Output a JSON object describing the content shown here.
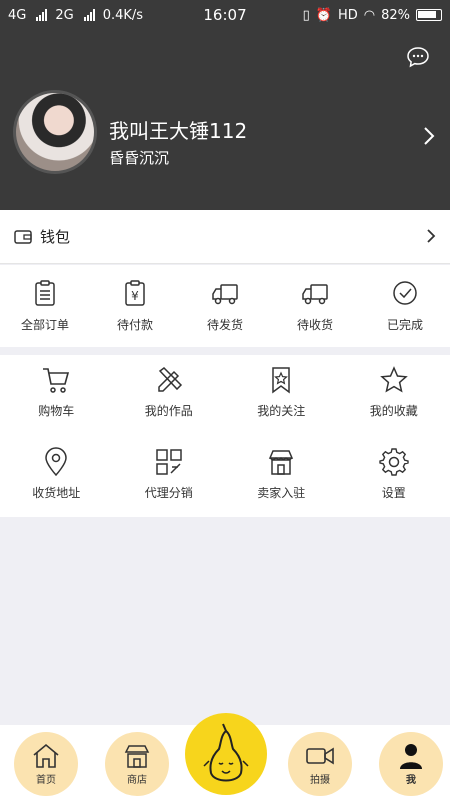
{
  "status_bar": {
    "net1": "4G",
    "net2": "2G",
    "speed": "0.4K/s",
    "time": "16:07",
    "hd": "HD",
    "battery": "82%"
  },
  "profile": {
    "name": "我叫王大锤112",
    "subtitle": "昏昏沉沉"
  },
  "wallet": {
    "label": "钱包"
  },
  "orders": [
    {
      "label": "全部订单",
      "icon": "clipboard-icon"
    },
    {
      "label": "待付款",
      "icon": "yen-payment-icon"
    },
    {
      "label": "待发货",
      "icon": "truck-icon"
    },
    {
      "label": "待收货",
      "icon": "truck-icon"
    },
    {
      "label": "已完成",
      "icon": "check-circle-icon"
    }
  ],
  "menu": [
    {
      "label": "购物车",
      "icon": "cart-icon"
    },
    {
      "label": "我的作品",
      "icon": "pencil-ruler-icon"
    },
    {
      "label": "我的关注",
      "icon": "bookmark-star-icon"
    },
    {
      "label": "我的收藏",
      "icon": "star-icon"
    },
    {
      "label": "收货地址",
      "icon": "location-pin-icon"
    },
    {
      "label": "代理分销",
      "icon": "qr-grid-icon"
    },
    {
      "label": "卖家入驻",
      "icon": "store-icon"
    },
    {
      "label": "设置",
      "icon": "gear-icon"
    }
  ],
  "bottom_nav": {
    "home": "首页",
    "shop": "商店",
    "shoot": "拍摄",
    "me": "我"
  },
  "colors": {
    "header_bg": "#3a3a3a",
    "accent_yellow": "#f7d51c",
    "nav_circle": "#fbe3b0"
  }
}
